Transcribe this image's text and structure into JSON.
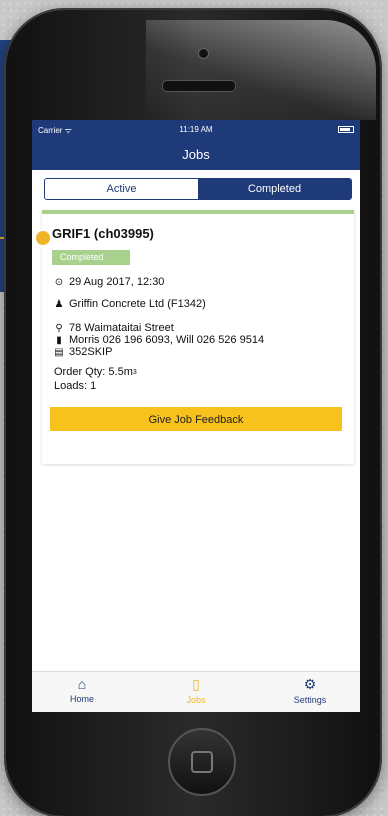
{
  "statusbar": {
    "carrier": "Carrier ᯤ",
    "time": "11:19 AM"
  },
  "navbar": {
    "title": "Jobs"
  },
  "segments": {
    "active": "Active",
    "completed": "Completed"
  },
  "job": {
    "title": "GRIF1 (ch03995)",
    "status": "Completed",
    "datetime": "29 Aug 2017, 12:30",
    "customer": "Griffin Concrete Ltd (F1342)",
    "address": "78 Waimataitai Street",
    "contacts": "Morris 026 196 6093, Will 026 526 9514",
    "equipment": "352SKIP",
    "order_qty_label": "Order Qty: 5.5m",
    "order_qty_sup": "3",
    "loads": "Loads: 1",
    "feedback_button": "Give Job Feedback"
  },
  "tabs": [
    {
      "label": "Home",
      "icon": "home-icon"
    },
    {
      "label": "Jobs",
      "icon": "document-icon"
    },
    {
      "label": "Settings",
      "icon": "gears-icon"
    }
  ],
  "colors": {
    "primary": "#1f3a78",
    "accent": "#f6c21b",
    "status_green": "#a9d18e",
    "tab_active": "#f0b429"
  }
}
